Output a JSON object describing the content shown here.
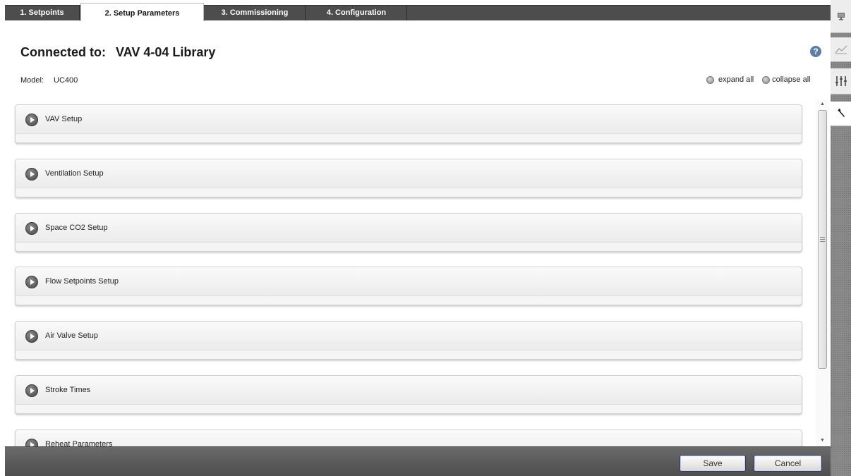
{
  "tabs": [
    {
      "label": "1. Setpoints",
      "active": false
    },
    {
      "label": "2. Setup Parameters",
      "active": true
    },
    {
      "label": "3. Commissioning",
      "active": false
    },
    {
      "label": "4. Configuration",
      "active": false
    }
  ],
  "header": {
    "connected_label": "Connected to:",
    "device_name": "VAV 4-04 Library",
    "model_label": "Model:",
    "model_value": "UC400",
    "help_glyph": "?"
  },
  "controls": {
    "expand_all": "expand all",
    "collapse_all": "collapse all"
  },
  "sections": [
    {
      "label": "VAV Setup"
    },
    {
      "label": "Ventilation Setup"
    },
    {
      "label": "Space CO2 Setup"
    },
    {
      "label": "Flow Setpoints Setup"
    },
    {
      "label": "Air Valve Setup"
    },
    {
      "label": "Stroke Times"
    },
    {
      "label": "Reheat Parameters"
    }
  ],
  "footer": {
    "save_label": "Save",
    "cancel_label": "Cancel"
  },
  "side_panel": {
    "icons": [
      "monitor-icon",
      "chart-icon",
      "sliders-icon",
      "wrench-icon"
    ],
    "active": "wrench-icon"
  },
  "colors": {
    "tabbar": "#4d4d4d",
    "footer": "#5a5a5a",
    "help": "#5b7fa6",
    "side_panel": "#8a8a8a"
  }
}
